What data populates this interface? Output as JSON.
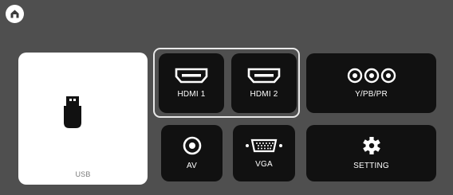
{
  "header": {
    "home_icon": "home-icon"
  },
  "inputs": {
    "usb": {
      "label": "USB",
      "icon": "usb-drive-icon"
    },
    "hdmi1": {
      "label": "HDMI 1",
      "icon": "hdmi-port-icon"
    },
    "hdmi2": {
      "label": "HDMI 2",
      "icon": "hdmi-port-icon"
    },
    "ypbpr": {
      "label": "Y/PB/PR",
      "icon": "component-rca-icon"
    },
    "av": {
      "label": "AV",
      "icon": "rca-jack-icon"
    },
    "vga": {
      "label": "VGA",
      "icon": "vga-port-icon"
    },
    "setting": {
      "label": "SETTING",
      "icon": "gear-icon"
    }
  },
  "selected": "hdmi1",
  "colors": {
    "background": "#4f4f4f",
    "tile": "#111111",
    "usb_tile": "#ffffff",
    "focus_frame": "#e8e8e8"
  }
}
